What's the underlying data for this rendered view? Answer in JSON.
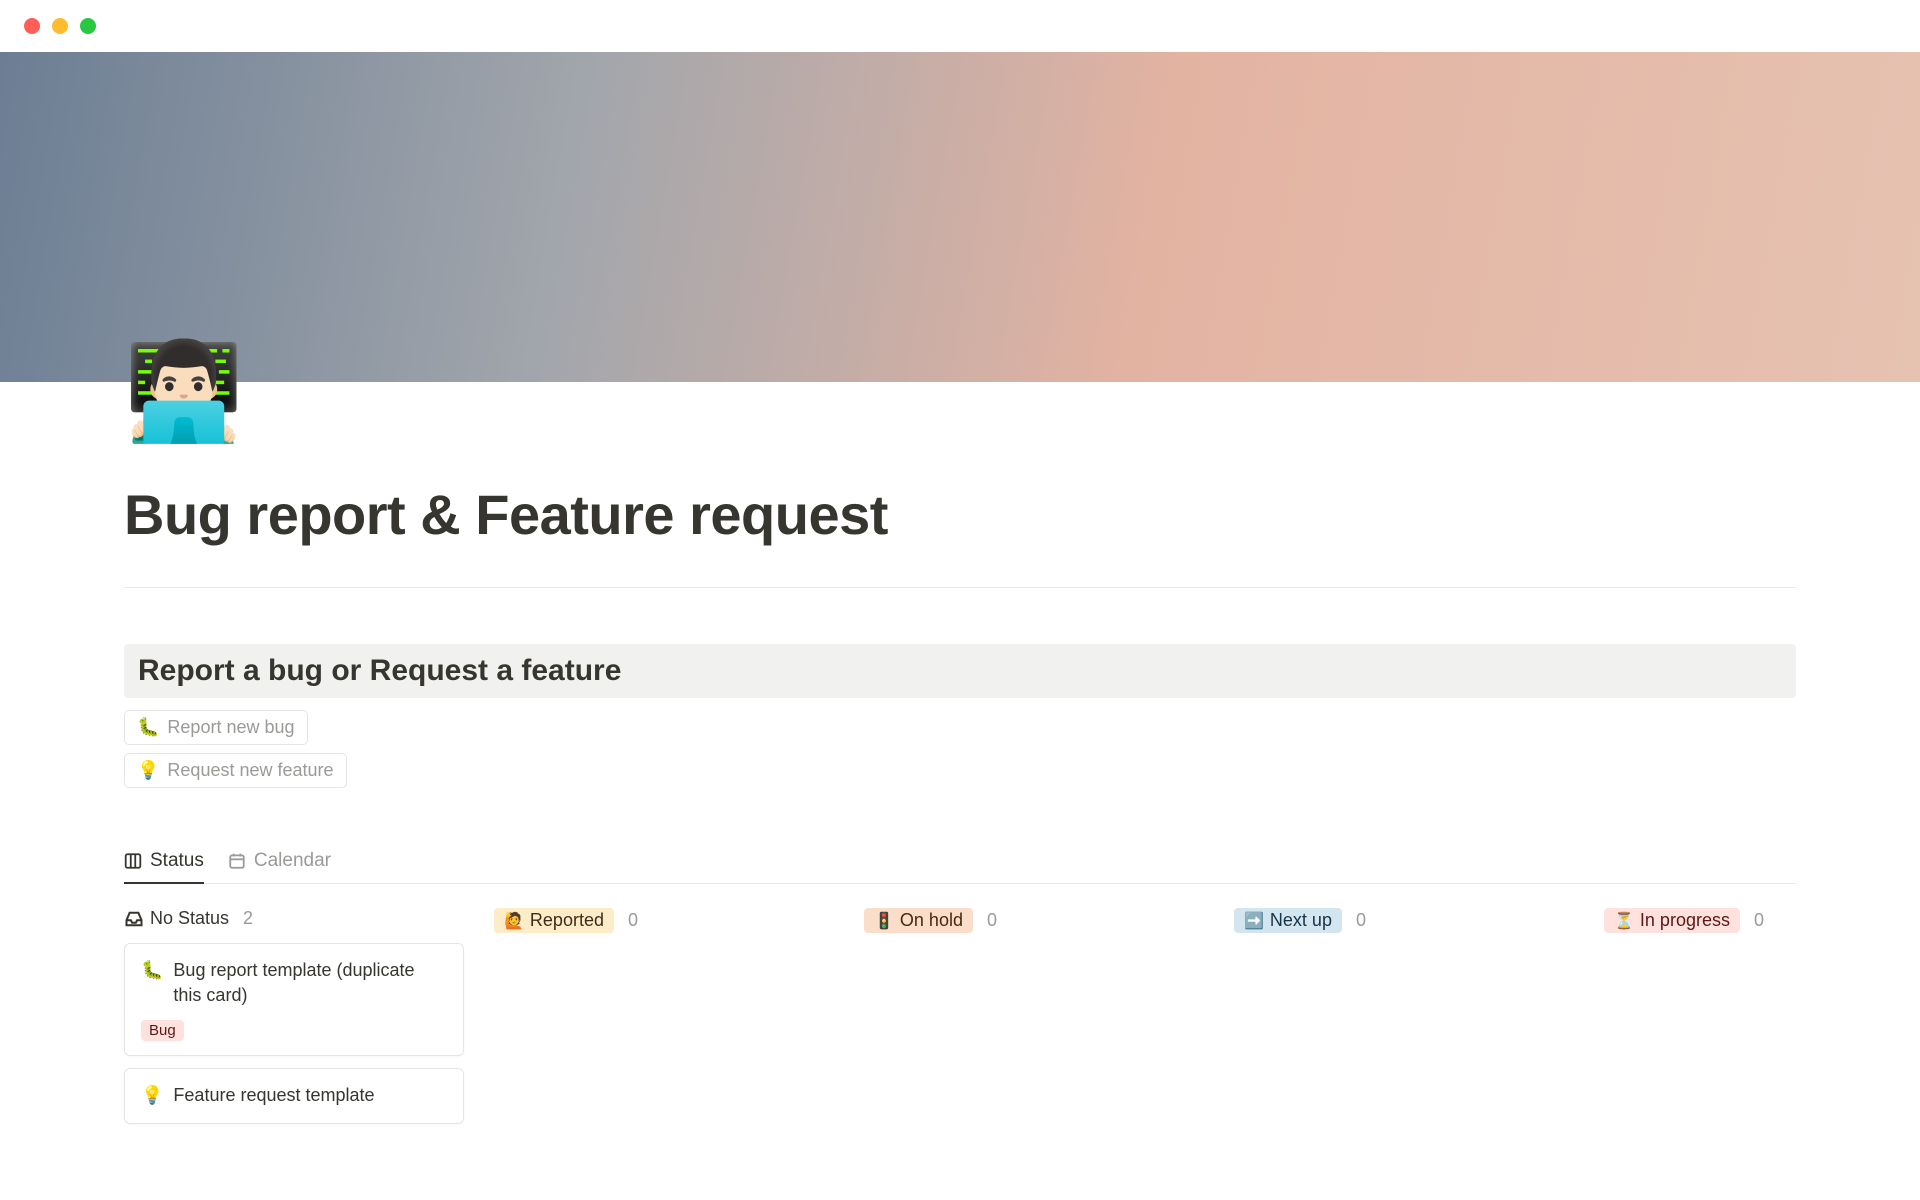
{
  "window": {
    "page_icon": "👨🏻‍💻"
  },
  "page": {
    "title": "Bug report & Feature request"
  },
  "callout": {
    "heading": "Report a bug or Request a feature"
  },
  "actions": [
    {
      "emoji": "🐛",
      "label": "Report new bug"
    },
    {
      "emoji": "💡",
      "label": "Request new feature"
    }
  ],
  "views": [
    {
      "id": "status",
      "label": "Status",
      "active": true
    },
    {
      "id": "calendar",
      "label": "Calendar",
      "active": false
    }
  ],
  "board": {
    "columns": [
      {
        "id": "no-status",
        "emoji": "",
        "label": "No Status",
        "count": "2",
        "style": "plain"
      },
      {
        "id": "reported",
        "emoji": "🙋",
        "label": "Reported",
        "count": "0",
        "style": "yellow"
      },
      {
        "id": "on-hold",
        "emoji": "🚦",
        "label": "On hold",
        "count": "0",
        "style": "orange"
      },
      {
        "id": "next-up",
        "emoji": "➡️",
        "label": "Next up",
        "count": "0",
        "style": "blue"
      },
      {
        "id": "in-progress",
        "emoji": "⏳",
        "label": "In progress",
        "count": "0",
        "style": "red"
      }
    ],
    "cards_no_status": [
      {
        "emoji": "🐛",
        "title": "Bug report template (duplicate this card)",
        "tag": "Bug"
      },
      {
        "emoji": "💡",
        "title": "Feature request template",
        "tag": ""
      }
    ]
  }
}
